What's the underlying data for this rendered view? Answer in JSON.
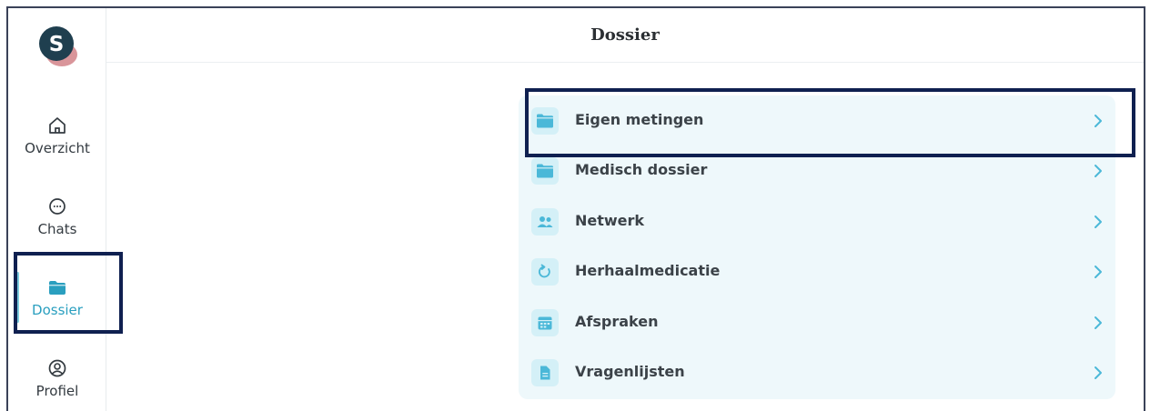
{
  "header": {
    "title": "Dossier"
  },
  "logo": {
    "letter": "S"
  },
  "sidebar": {
    "items": [
      {
        "label": "Overzicht",
        "icon": "home-icon",
        "active": false
      },
      {
        "label": "Chats",
        "icon": "chat-bubble-icon",
        "active": false
      },
      {
        "label": "Dossier",
        "icon": "folder-icon",
        "active": true
      },
      {
        "label": "Profiel",
        "icon": "user-circle-icon",
        "active": false
      }
    ]
  },
  "dossier": {
    "items": [
      {
        "label": "Eigen metingen",
        "icon": "folder-icon"
      },
      {
        "label": "Medisch dossier",
        "icon": "folder-icon"
      },
      {
        "label": "Netwerk",
        "icon": "people-icon"
      },
      {
        "label": "Herhaalmedicatie",
        "icon": "refresh-icon"
      },
      {
        "label": "Afspraken",
        "icon": "calendar-icon"
      },
      {
        "label": "Vragenlijsten",
        "icon": "document-icon"
      }
    ]
  },
  "colors": {
    "accent": "#2a9fbf",
    "icon_fill": "#4bb8d8",
    "list_bg": "#eef8fb",
    "highlight": "#0f2050",
    "logo_dark": "#1f3f4f",
    "logo_pink": "#d9959a"
  }
}
